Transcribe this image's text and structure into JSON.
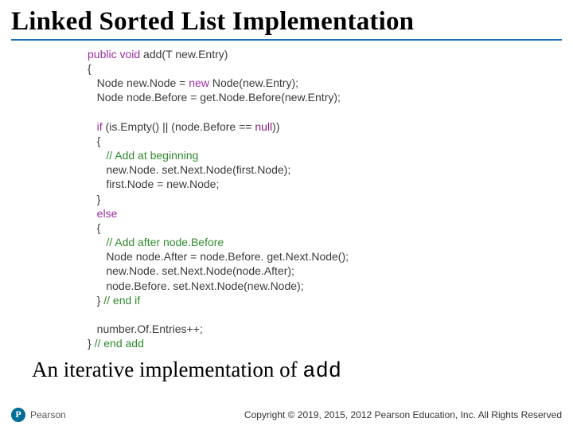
{
  "title": "Linked Sorted List Implementation",
  "code": {
    "l01a": "public",
    "l01b": " ",
    "l01c": "void",
    "l01d": " add(T new.Entry)",
    "l02": "{",
    "l03a": "   Node new.Node = ",
    "l03b": "new",
    "l03c": " Node(new.Entry);",
    "l04": "   Node node.Before = get.Node.Before(new.Entry);",
    "blank1": "",
    "l05a": "   ",
    "l05b": "if",
    "l05c": " (is.Empty() || (node.Before == ",
    "l05d": "null",
    "l05e": "))",
    "l06": "   {",
    "l07": "      // Add at beginning",
    "l08": "      new.Node. set.Next.Node(first.Node);",
    "l09": "      first.Node = new.Node;",
    "l10": "   }",
    "l11": "   else",
    "l12": "   {",
    "l13": "      // Add after node.Before",
    "l14": "      Node node.After = node.Before. get.Next.Node();",
    "l15": "      new.Node. set.Next.Node(node.After);",
    "l16": "      node.Before. set.Next.Node(new.Node);",
    "l17a": "   } ",
    "l17b": "// end if",
    "blank2": "",
    "l18": "   number.Of.Entries++;",
    "l19a": "} ",
    "l19b": "// end add"
  },
  "caption_prefix": "An iterative implementation of ",
  "caption_code": "add",
  "brand": "Pearson",
  "copyright": "Copyright © 2019, 2015, 2012 Pearson Education, Inc. All Rights Reserved"
}
